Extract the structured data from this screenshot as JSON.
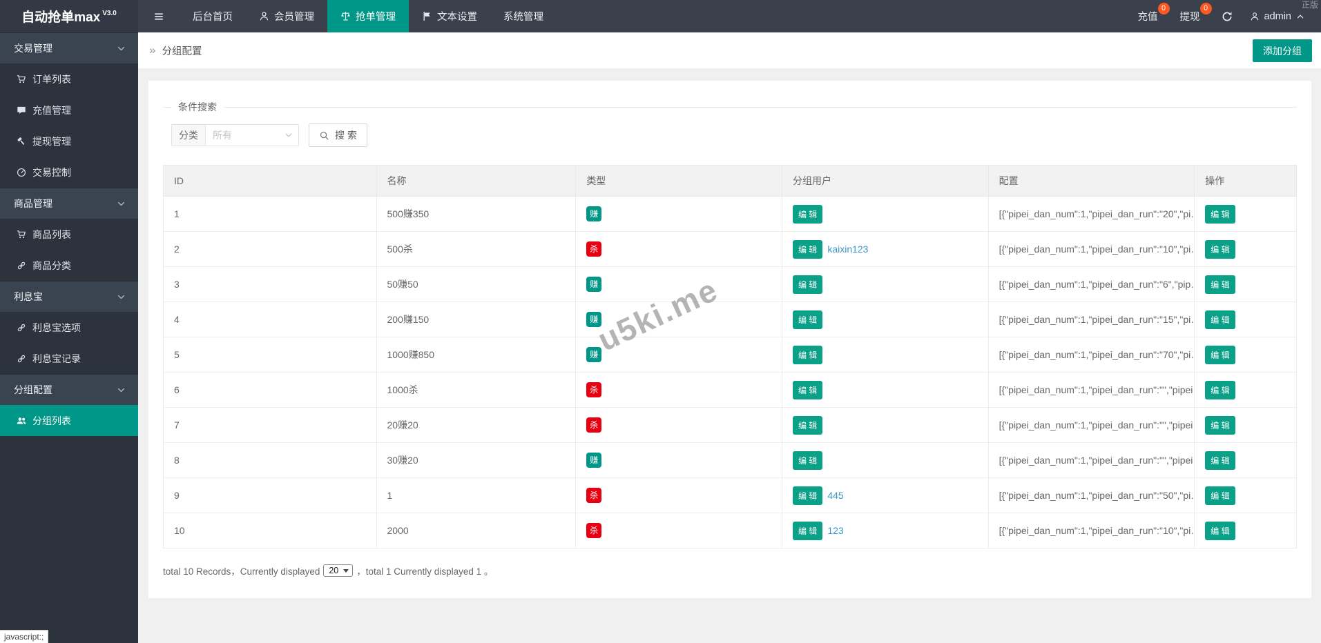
{
  "app": {
    "title": "自动抢单max",
    "version": "V3.0",
    "license": "正版"
  },
  "navbar": {
    "items": [
      {
        "label": "后台首页"
      },
      {
        "label": "会员管理"
      },
      {
        "label": "抢单管理",
        "active": true
      },
      {
        "label": "文本设置"
      },
      {
        "label": "系统管理"
      }
    ],
    "recharge_label": "充值",
    "recharge_badge": "0",
    "withdraw_label": "提现",
    "withdraw_badge": "0",
    "username": "admin"
  },
  "sidebar": {
    "items": [
      {
        "label": "交易管理",
        "type": "header"
      },
      {
        "label": "订单列表",
        "icon": "cart-icon"
      },
      {
        "label": "充值管理",
        "icon": "comment-icon"
      },
      {
        "label": "提现管理",
        "icon": "gavel-icon"
      },
      {
        "label": "交易控制",
        "icon": "gauge-icon"
      },
      {
        "label": "商品管理",
        "type": "header"
      },
      {
        "label": "商品列表",
        "icon": "cart-icon"
      },
      {
        "label": "商品分类",
        "icon": "link-icon"
      },
      {
        "label": "利息宝",
        "type": "header"
      },
      {
        "label": "利息宝选项",
        "icon": "link-icon"
      },
      {
        "label": "利息宝记录",
        "icon": "link-icon"
      },
      {
        "label": "分组配置",
        "type": "header"
      },
      {
        "label": "分组列表",
        "icon": "users-icon",
        "active": true
      }
    ]
  },
  "breadcrumb": {
    "icon": "»",
    "title": "分组配置"
  },
  "toolbar": {
    "add_group_label": "添加分组"
  },
  "search": {
    "legend": "条件搜索",
    "category_label": "分类",
    "category_placeholder": "所有",
    "button_label": "搜 索"
  },
  "table": {
    "headers": [
      "ID",
      "名称",
      "类型",
      "分组用户",
      "配置",
      "操作"
    ],
    "edit_label": "编 辑",
    "rows": [
      {
        "id": "1",
        "name": "500赚350",
        "type_label": "赚",
        "type_key": "zhuan",
        "group_link": "",
        "config": "[{\"pipei_dan_num\":1,\"pipei_dan_run\":\"20\",\"pi…"
      },
      {
        "id": "2",
        "name": "500杀",
        "type_label": "杀",
        "type_key": "sha",
        "group_link": "kaixin123",
        "config": "[{\"pipei_dan_num\":1,\"pipei_dan_run\":\"10\",\"pi…"
      },
      {
        "id": "3",
        "name": "50赚50",
        "type_label": "赚",
        "type_key": "zhuan",
        "group_link": "",
        "config": "[{\"pipei_dan_num\":1,\"pipei_dan_run\":\"6\",\"pip…"
      },
      {
        "id": "4",
        "name": "200赚150",
        "type_label": "赚",
        "type_key": "zhuan",
        "group_link": "",
        "config": "[{\"pipei_dan_num\":1,\"pipei_dan_run\":\"15\",\"pi…"
      },
      {
        "id": "5",
        "name": "1000赚850",
        "type_label": "赚",
        "type_key": "zhuan",
        "group_link": "",
        "config": "[{\"pipei_dan_num\":1,\"pipei_dan_run\":\"70\",\"pi…"
      },
      {
        "id": "6",
        "name": "1000杀",
        "type_label": "杀",
        "type_key": "sha",
        "group_link": "",
        "config": "[{\"pipei_dan_num\":1,\"pipei_dan_run\":\"\",\"pipei…"
      },
      {
        "id": "7",
        "name": "20赚20",
        "type_label": "杀",
        "type_key": "sha",
        "group_link": "",
        "config": "[{\"pipei_dan_num\":1,\"pipei_dan_run\":\"\",\"pipei…"
      },
      {
        "id": "8",
        "name": "30赚20",
        "type_label": "赚",
        "type_key": "zhuan",
        "group_link": "",
        "config": "[{\"pipei_dan_num\":1,\"pipei_dan_run\":\"\",\"pipei…"
      },
      {
        "id": "9",
        "name": "1",
        "type_label": "杀",
        "type_key": "sha",
        "group_link": "445",
        "config": "[{\"pipei_dan_num\":1,\"pipei_dan_run\":\"50\",\"pi…"
      },
      {
        "id": "10",
        "name": "2000",
        "type_label": "杀",
        "type_key": "sha",
        "group_link": "123",
        "config": "[{\"pipei_dan_num\":1,\"pipei_dan_run\":\"10\",\"pi…"
      }
    ]
  },
  "footer": {
    "text_before": "total 10 Records，Currently displayed",
    "page_size": "20",
    "text_after": "，total 1 Currently displayed 1 。"
  },
  "watermark": "u5ki.me",
  "statusbar": "javascript:;",
  "colors": {
    "accent": "#009688",
    "button": "#0ba189",
    "danger": "#e60012",
    "badge": "#ff5722",
    "link": "#3a96c8"
  },
  "icons": [
    "hamburger-icon",
    "user-icon",
    "scale-icon",
    "flag-icon",
    "refresh-icon",
    "chevron-up-icon",
    "chevron-down-icon",
    "cart-icon",
    "comment-icon",
    "gavel-icon",
    "gauge-icon",
    "link-icon",
    "users-icon",
    "search-icon",
    "breadcrumb-icon"
  ]
}
